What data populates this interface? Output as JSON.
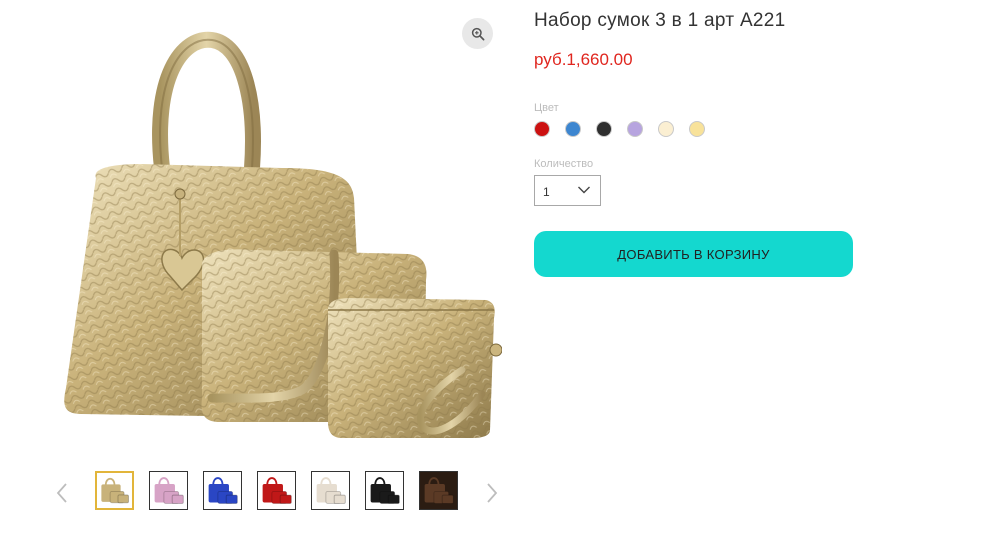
{
  "product": {
    "title": "Набор сумок 3 в 1 арт A221",
    "price": "руб.1,660.00",
    "price_color": "#e0261f"
  },
  "options": {
    "color_label": "Цвет",
    "colors": [
      {
        "name": "red",
        "hex": "#cc1111",
        "selected": false
      },
      {
        "name": "blue",
        "hex": "#3d86d0",
        "selected": false
      },
      {
        "name": "black",
        "hex": "#2f2f2f",
        "selected": false
      },
      {
        "name": "lavender",
        "hex": "#b7a4df",
        "selected": false
      },
      {
        "name": "cream",
        "hex": "#fbefd2",
        "selected": false
      },
      {
        "name": "yellow",
        "hex": "#f8e29a",
        "selected": false
      }
    ],
    "quantity_label": "Количество",
    "quantity_value": "1"
  },
  "cart": {
    "add_label": "ДОБАВИТЬ В КОРЗИНУ",
    "button_color": "#14d8cf"
  },
  "gallery": {
    "zoom_icon": "magnifier-icon",
    "thumbnails": [
      {
        "color": "gold",
        "hex": "#c8b27a",
        "active": true
      },
      {
        "color": "pink",
        "hex": "#d7a3c6",
        "active": false
      },
      {
        "color": "blue",
        "hex": "#2a46c4",
        "active": false
      },
      {
        "color": "red",
        "hex": "#c01818",
        "active": false
      },
      {
        "color": "white",
        "hex": "#e6ddd0",
        "active": false
      },
      {
        "color": "black",
        "hex": "#1a1a1a",
        "active": false
      },
      {
        "color": "brown",
        "hex": "#5b3a25",
        "active": false
      }
    ]
  }
}
